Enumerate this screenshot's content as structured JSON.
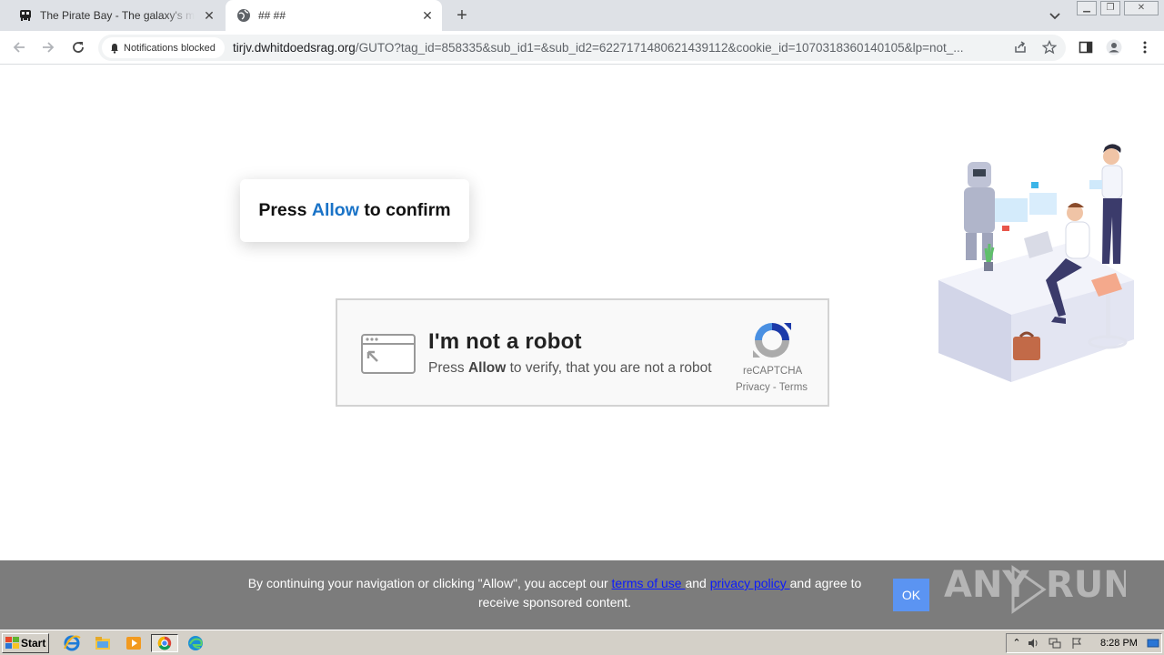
{
  "browser": {
    "tabs": [
      {
        "title": "The Pirate Bay - The galaxy's most resilient BitTorrent site",
        "active": false
      },
      {
        "title": "## ##",
        "active": true
      }
    ],
    "notifications_chip": "Notifications blocked",
    "url_host": "tirjv.dwhitdoedsrag.org",
    "url_path": "/GUTO?tag_id=858335&sub_id1=&sub_id2=6227171480621439112&cookie_id=1070318360140105&lp=not_..."
  },
  "page": {
    "confirm": {
      "prefix": "Press ",
      "highlight": "Allow",
      "suffix": " to confirm"
    },
    "captcha": {
      "heading": "I'm not a robot",
      "sub_prefix": "Press ",
      "sub_bold": "Allow",
      "sub_suffix": " to verify, that you are not a robot",
      "brand": "reCAPTCHA",
      "links": "Privacy - Terms"
    }
  },
  "consent": {
    "text_before": "By continuing your navigation or clicking \"Allow\", you accept our ",
    "terms_link": "terms of use ",
    "text_and": "and ",
    "privacy_link": "privacy policy ",
    "text_after": "and agree to receive sponsored content.",
    "ok_label": "OK",
    "watermark": "ANY RUN"
  },
  "taskbar": {
    "start_label": "Start",
    "clock": "8:28 PM"
  },
  "colors": {
    "allow_blue": "#1a73c7",
    "consent_bg": "#7c7c7c",
    "ok_button": "#5b94f2",
    "link_blue": "#0a1aff"
  },
  "icons": [
    "pirate-favicon",
    "globe-favicon",
    "back-arrow",
    "forward-arrow",
    "reload",
    "bell",
    "share",
    "star",
    "side-panel",
    "profile",
    "kebab-menu",
    "recaptcha-logo",
    "windows-flag",
    "ie",
    "explorer",
    "media-player",
    "chrome",
    "edge"
  ]
}
